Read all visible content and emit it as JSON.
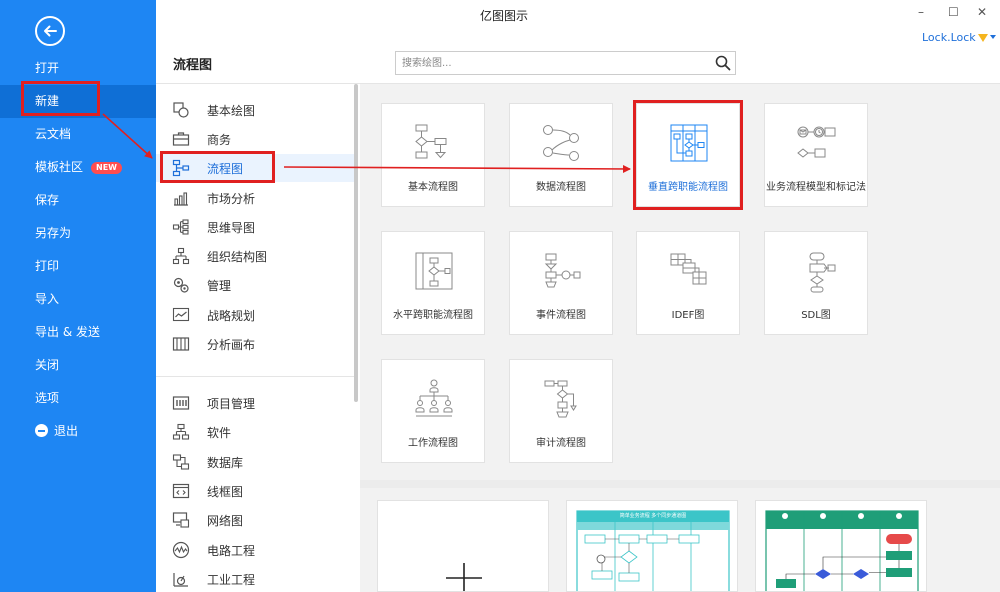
{
  "window": {
    "title": "亿图图示",
    "minimize": "–",
    "maximize": "☐",
    "close": "✕"
  },
  "user": {
    "name": "Lock.Lock"
  },
  "sidebar": {
    "items": [
      {
        "label": "打开"
      },
      {
        "label": "新建"
      },
      {
        "label": "云文档"
      },
      {
        "label": "模板社区",
        "badge": "NEW"
      },
      {
        "label": "保存"
      },
      {
        "label": "另存为"
      },
      {
        "label": "打印"
      },
      {
        "label": "导入"
      },
      {
        "label": "导出 & 发送"
      },
      {
        "label": "关闭"
      },
      {
        "label": "选项"
      },
      {
        "label": "退出"
      }
    ]
  },
  "header": {
    "section_title": "流程图",
    "search_placeholder": "搜索绘图..."
  },
  "categories": [
    {
      "label": "基本绘图",
      "icon": "shapes-icon"
    },
    {
      "label": "商务",
      "icon": "briefcase-icon"
    },
    {
      "label": "流程图",
      "icon": "flowchart-icon",
      "selected": true
    },
    {
      "label": "市场分析",
      "icon": "bar-chart-icon"
    },
    {
      "label": "思维导图",
      "icon": "mindmap-icon"
    },
    {
      "label": "组织结构图",
      "icon": "org-chart-icon"
    },
    {
      "label": "管理",
      "icon": "gears-icon"
    },
    {
      "label": "战略规划",
      "icon": "strategy-icon"
    },
    {
      "label": "分析画布",
      "icon": "canvas-icon"
    },
    {
      "label": "项目管理",
      "icon": "project-icon"
    },
    {
      "label": "软件",
      "icon": "software-icon"
    },
    {
      "label": "数据库",
      "icon": "database-icon"
    },
    {
      "label": "线框图",
      "icon": "wireframe-icon"
    },
    {
      "label": "网络图",
      "icon": "network-icon"
    },
    {
      "label": "电路工程",
      "icon": "circuit-icon"
    },
    {
      "label": "工业工程",
      "icon": "industrial-icon"
    }
  ],
  "templates": [
    {
      "label": "基本流程图"
    },
    {
      "label": "数据流程图"
    },
    {
      "label": "垂直跨职能流程图",
      "selected": true
    },
    {
      "label": "业务流程模型和标记法"
    },
    {
      "label": "水平跨职能流程图"
    },
    {
      "label": "事件流程图"
    },
    {
      "label": "IDEF图"
    },
    {
      "label": "SDL图"
    },
    {
      "label": "工作流程图"
    },
    {
      "label": "审计流程图"
    }
  ],
  "gallery": {
    "card2_title": "简单业务流程 多个同步通道图"
  },
  "colors": {
    "sidebar": "#1e86f3",
    "accent": "#1e6fd9",
    "highlight": "#e02020",
    "teal": "#3cc5c8",
    "green": "#1f9e78"
  }
}
